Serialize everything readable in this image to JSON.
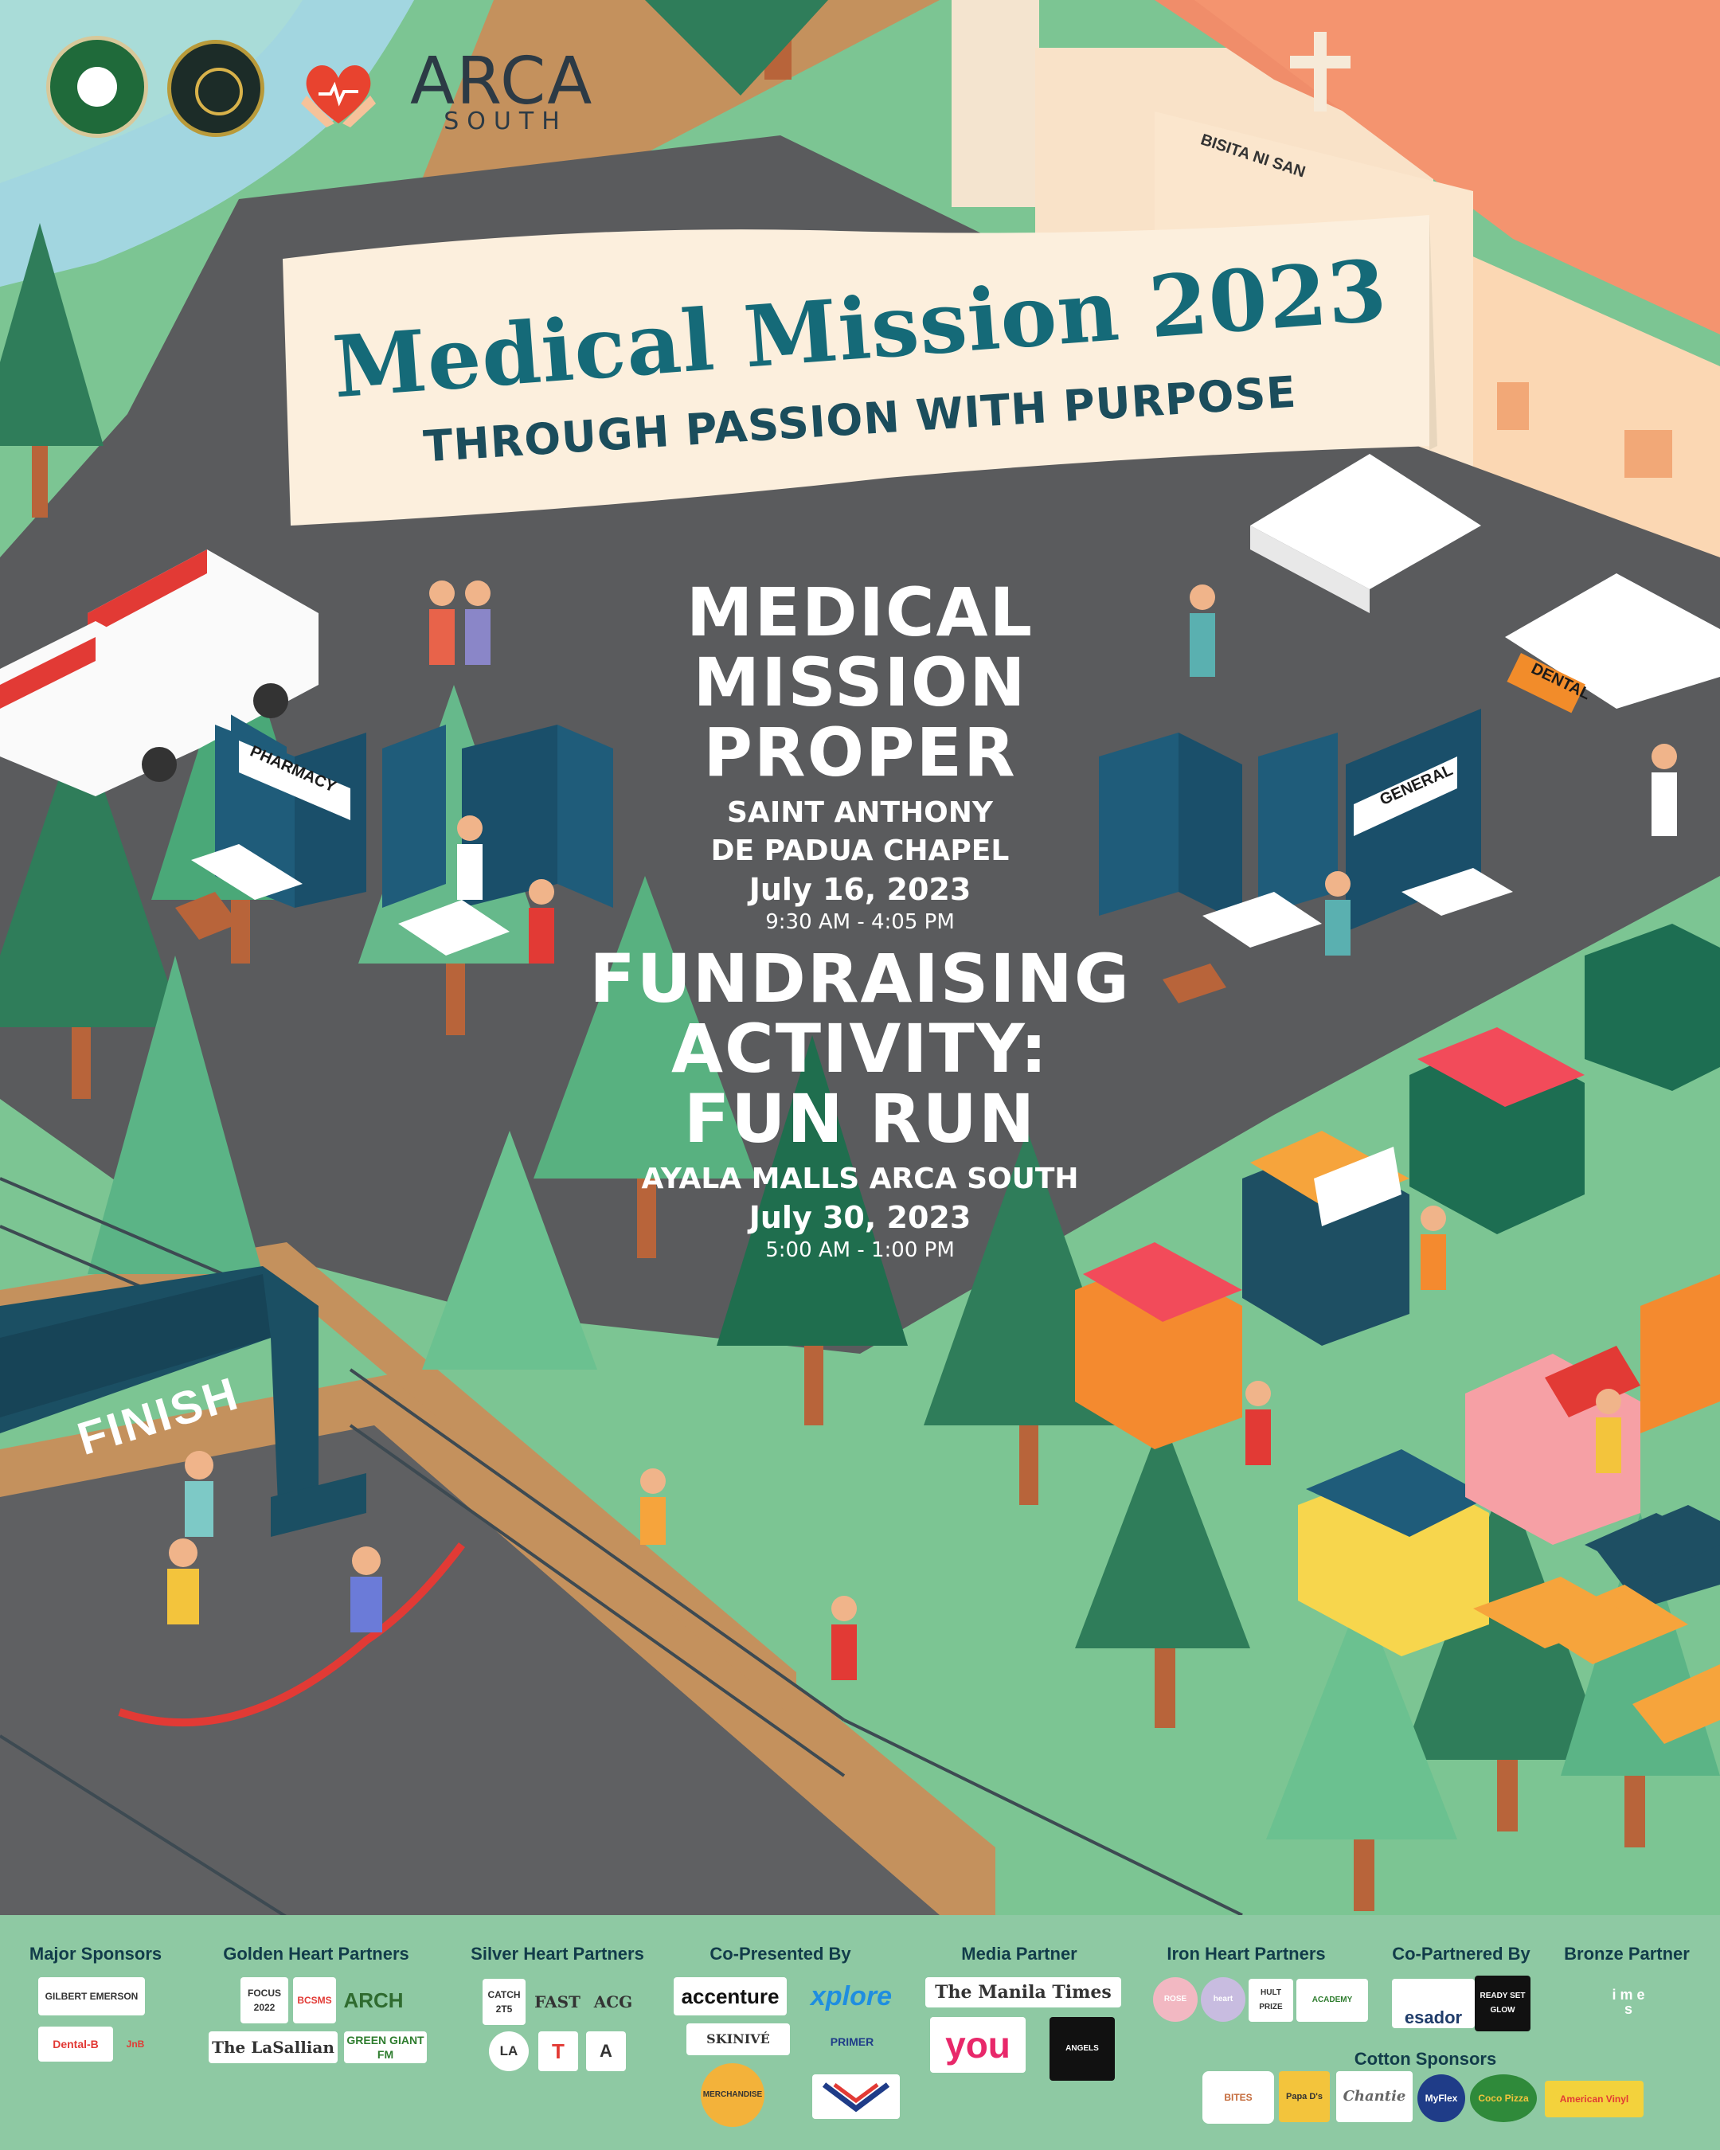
{
  "header": {
    "logos": [
      "Council of Student Organizations DLSU",
      "ANGELICOM",
      "heart-hands-icon"
    ],
    "arca_main": "ARCA",
    "arca_sub": "SOUTH"
  },
  "scene": {
    "church_sign": "BISITA NI SAN",
    "pharmacy_sign": "PHARMACY",
    "general_sign": "GENERAL",
    "dental_sign": "DENTAL",
    "finish_sign": "FINISH"
  },
  "banner": {
    "title": "Medical Mission 2023",
    "subtitle": "THROUGH PASSION WITH PURPOSE"
  },
  "event1": {
    "line1": "MEDICAL",
    "line2": "MISSION",
    "line3": "PROPER",
    "venue1": "SAINT ANTHONY",
    "venue2": "DE PADUA CHAPEL",
    "date": "July 16, 2023",
    "time": "9:30 AM - 4:05 PM"
  },
  "event2": {
    "line1": "FUNDRAISING",
    "line2": "ACTIVITY:",
    "line3": "FUN RUN",
    "venue": "AYALA MALLS ARCA SOUTH",
    "date": "July 30, 2023",
    "time": "5:00 AM - 1:00 PM"
  },
  "sponsors": {
    "major": {
      "label": "Major Sponsors",
      "logos": [
        "GILBERT EMERSON",
        "Dental-B",
        "JnB"
      ]
    },
    "golden": {
      "label": "Golden Heart Partners",
      "logos": [
        "FOCUS 2022",
        "BCSMS",
        "ARCH",
        "The LaSallian",
        "GREEN GIANT FM"
      ]
    },
    "silver": {
      "label": "Silver Heart Partners",
      "logos": [
        "CATCH 2T5",
        "FAST",
        "ACG",
        "LA",
        "T",
        "A"
      ]
    },
    "copresented": {
      "label": "Co-Presented By",
      "logos": [
        "accenture",
        "xplore",
        "SKINIVÉ",
        "PRIMER",
        "MERCHANDISE"
      ]
    },
    "media": {
      "label": "Media Partner",
      "logos": [
        "The Manila Times",
        "you",
        "ANGELS"
      ]
    },
    "iron": {
      "label": "Iron Heart Partners",
      "logos": [
        "ROSE",
        "heart",
        "HULT PRIZE",
        "ACADEMY"
      ]
    },
    "copartnered": {
      "label": "Co-Partnered By",
      "logos": [
        "esador",
        "READY SET GLOW"
      ]
    },
    "bronze": {
      "label": "Bronze Partner",
      "logos": [
        "i m e s"
      ]
    },
    "cotton": {
      "label": "Cotton Sponsors",
      "logos": [
        "BITES",
        "Papa D's",
        "Chantie",
        "MyFlex",
        "Coco Pizza",
        "American Vinyl"
      ]
    }
  }
}
